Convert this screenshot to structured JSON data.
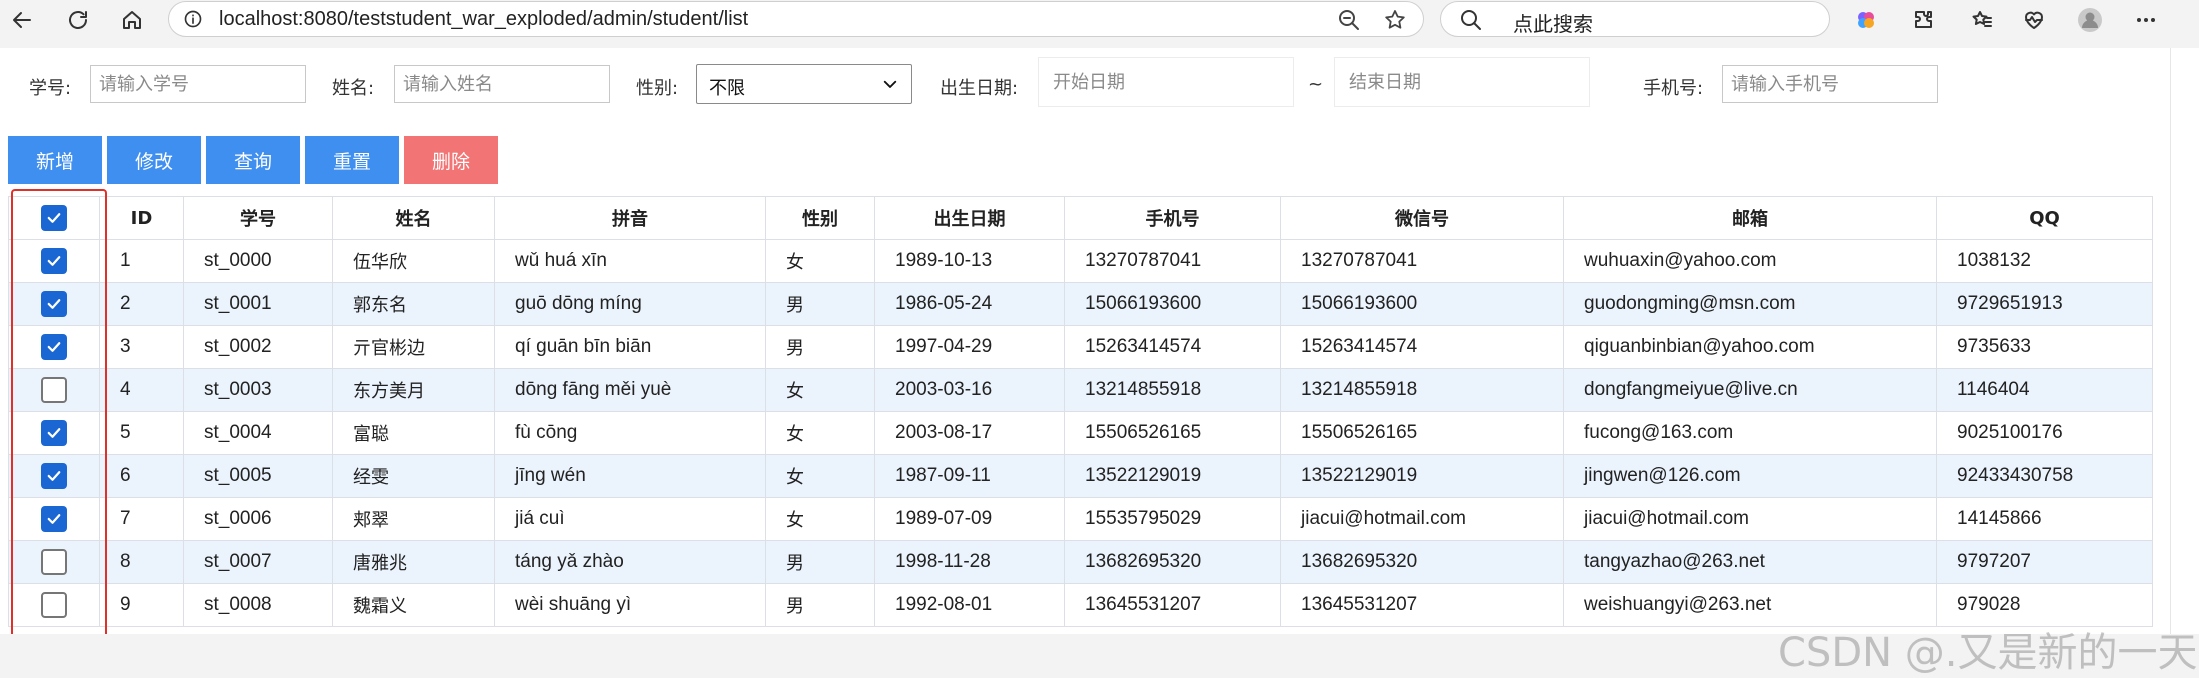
{
  "browser": {
    "url": "localhost:8080/teststudent_war_exploded/admin/student/list",
    "search_label": "点此搜索"
  },
  "filters": {
    "student_no_label": "学号:",
    "student_no_placeholder": "请输入学号",
    "name_label": "姓名:",
    "name_placeholder": "请输入姓名",
    "gender_label": "性别:",
    "gender_value": "不限",
    "birth_label": "出生日期:",
    "start_date_placeholder": "开始日期",
    "range_sep": "~",
    "end_date_placeholder": "结束日期",
    "phone_label": "手机号:",
    "phone_placeholder": "请输入手机号"
  },
  "toolbar": {
    "add_label": "新增",
    "edit_label": "修改",
    "query_label": "查询",
    "reset_label": "重置",
    "delete_label": "删除"
  },
  "table": {
    "columns": [
      "ID",
      "学号",
      "姓名",
      "拼音",
      "性别",
      "出生日期",
      "手机号",
      "微信号",
      "邮箱",
      "QQ"
    ],
    "header_checked": true,
    "rows": [
      {
        "checked": true,
        "id": "1",
        "no": "st_0000",
        "name": "伍华欣",
        "pinyin": "wǔ huá xīn",
        "gender": "女",
        "birth": "1989-10-13",
        "phone": "13270787041",
        "wechat": "13270787041",
        "email": "wuhuaxin@yahoo.com",
        "qq": "1038132"
      },
      {
        "checked": true,
        "id": "2",
        "no": "st_0001",
        "name": "郭东名",
        "pinyin": "guō dōng míng",
        "gender": "男",
        "birth": "1986-05-24",
        "phone": "15066193600",
        "wechat": "15066193600",
        "email": "guodongming@msn.com",
        "qq": "9729651913"
      },
      {
        "checked": true,
        "id": "3",
        "no": "st_0002",
        "name": "亓官彬边",
        "pinyin": "qí guān bīn biān",
        "gender": "男",
        "birth": "1997-04-29",
        "phone": "15263414574",
        "wechat": "15263414574",
        "email": "qiguanbinbian@yahoo.com",
        "qq": "9735633"
      },
      {
        "checked": false,
        "id": "4",
        "no": "st_0003",
        "name": "东方美月",
        "pinyin": "dōng fāng měi yuè",
        "gender": "女",
        "birth": "2003-03-16",
        "phone": "13214855918",
        "wechat": "13214855918",
        "email": "dongfangmeiyue@live.cn",
        "qq": "1146404"
      },
      {
        "checked": true,
        "id": "5",
        "no": "st_0004",
        "name": "富聪",
        "pinyin": "fù cōng",
        "gender": "女",
        "birth": "2003-08-17",
        "phone": "15506526165",
        "wechat": "15506526165",
        "email": "fucong@163.com",
        "qq": "9025100176"
      },
      {
        "checked": true,
        "id": "6",
        "no": "st_0005",
        "name": "经雯",
        "pinyin": "jīng wén",
        "gender": "女",
        "birth": "1987-09-11",
        "phone": "13522129019",
        "wechat": "13522129019",
        "email": "jingwen@126.com",
        "qq": "92433430758"
      },
      {
        "checked": true,
        "id": "7",
        "no": "st_0006",
        "name": "郏翠",
        "pinyin": "jiá cuì",
        "gender": "女",
        "birth": "1989-07-09",
        "phone": "15535795029",
        "wechat": "jiacui@hotmail.com",
        "email": "jiacui@hotmail.com",
        "qq": "14145866"
      },
      {
        "checked": false,
        "id": "8",
        "no": "st_0007",
        "name": "唐雅兆",
        "pinyin": "táng yǎ zhào",
        "gender": "男",
        "birth": "1998-11-28",
        "phone": "13682695320",
        "wechat": "13682695320",
        "email": "tangyazhao@263.net",
        "qq": "9797207"
      },
      {
        "checked": false,
        "id": "9",
        "no": "st_0008",
        "name": "魏霜义",
        "pinyin": "wèi shuāng yì",
        "gender": "男",
        "birth": "1992-08-01",
        "phone": "13645531207",
        "wechat": "13645531207",
        "email": "weishuangyi@263.net",
        "qq": "979028"
      }
    ]
  },
  "watermark": "CSDN @.又是新的一天.",
  "colors": {
    "primary_button": "#3f8ff0",
    "danger_button": "#f27474",
    "row_stripe": "#ebf3fc",
    "checkbox_checked": "#1a66d2",
    "highlight_box": "#e0302a"
  }
}
